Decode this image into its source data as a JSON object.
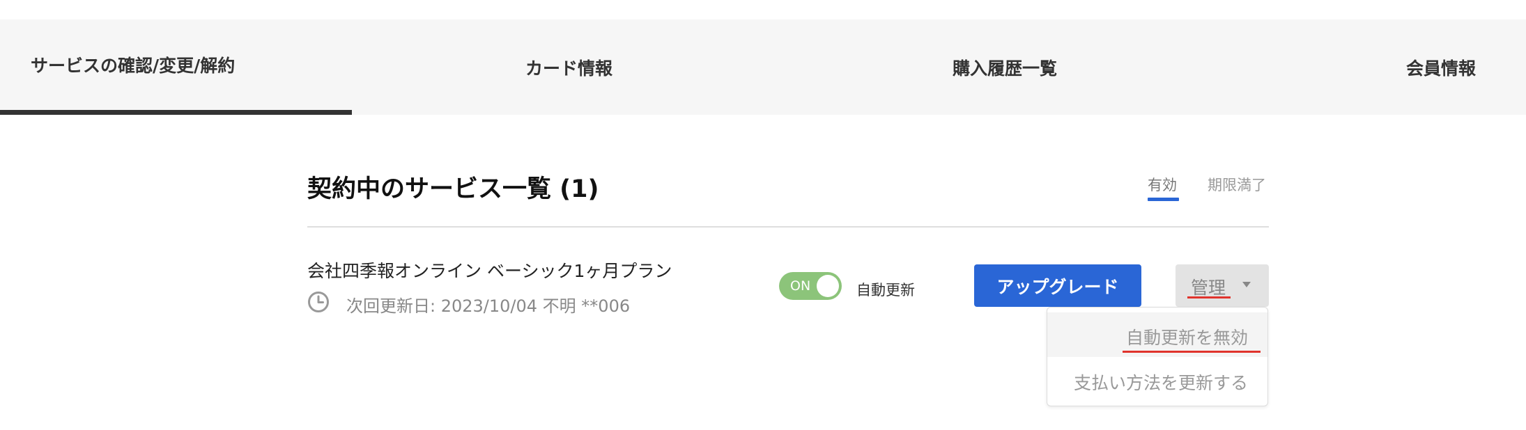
{
  "tabs": [
    {
      "label": "サービスの確認/変更/解約",
      "active": true
    },
    {
      "label": "カード情報",
      "active": false
    },
    {
      "label": "購入履歴一覧",
      "active": false
    },
    {
      "label": "会員情報",
      "active": false
    }
  ],
  "section": {
    "title": "契約中のサービス一覧 (1)",
    "filters": [
      {
        "label": "有効",
        "active": true
      },
      {
        "label": "期限満了",
        "active": false
      }
    ]
  },
  "service": {
    "name": "会社四季報オンライン ベーシック1ヶ月プラン",
    "next_renewal": "次回更新日: 2023/10/04 不明 **006",
    "toggle_state": "ON",
    "toggle_label": "自動更新",
    "upgrade_label": "アップグレード",
    "manage_label": "管理"
  },
  "dropdown": {
    "items": [
      {
        "label": "自動更新を無効"
      },
      {
        "label": "支払い方法を更新する"
      }
    ]
  },
  "colors": {
    "accent_blue": "#2a66d6",
    "toggle_green": "#8cc47a",
    "annotation_red": "#e0332c",
    "tab_bar_bg": "#f6f6f6"
  },
  "icons": {
    "renewal": "clock-icon",
    "manage_dropdown": "caret-down-icon"
  }
}
